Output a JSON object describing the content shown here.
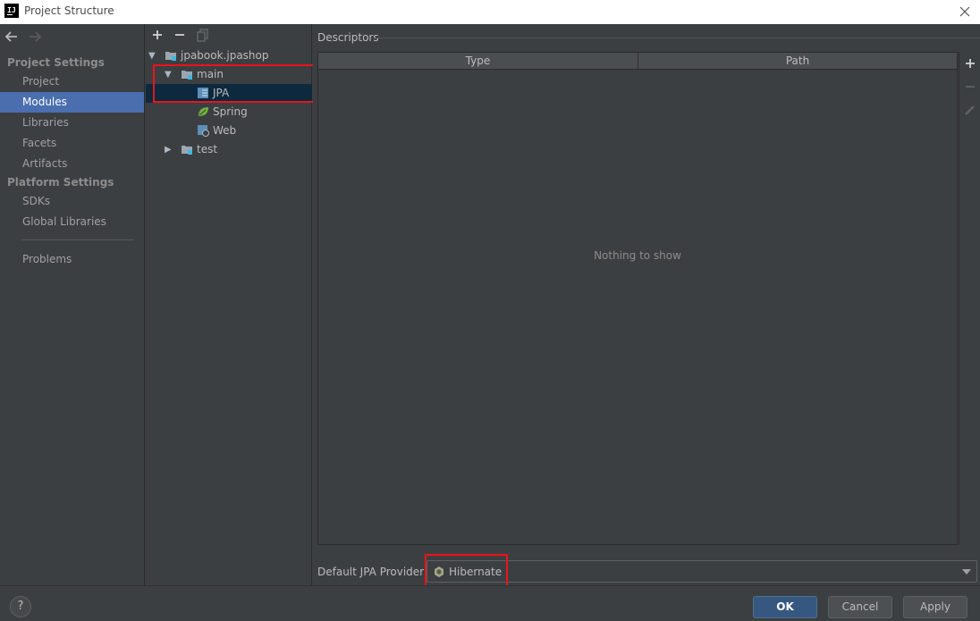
{
  "window": {
    "title": "Project Structure",
    "app_icon_text": "IJ"
  },
  "nav": {
    "project_settings_header": "Project Settings",
    "project_settings_items": [
      "Project",
      "Modules",
      "Libraries",
      "Facets",
      "Artifacts"
    ],
    "platform_settings_header": "Platform Settings",
    "platform_settings_items": [
      "SDKs",
      "Global Libraries"
    ],
    "problems": "Problems",
    "selected": "Modules"
  },
  "tree": {
    "nodes": [
      {
        "label": "jpabook.jpashop",
        "expanded": true
      },
      {
        "label": "main",
        "expanded": true
      },
      {
        "label": "JPA",
        "selected": true
      },
      {
        "label": "Spring"
      },
      {
        "label": "Web"
      },
      {
        "label": "test",
        "expanded": false
      }
    ]
  },
  "descriptors": {
    "section_title": "Descriptors",
    "columns": [
      "Type",
      "Path"
    ],
    "empty_text": "Nothing to show"
  },
  "provider": {
    "label": "Default JPA Provider",
    "value": "Hibernate"
  },
  "buttons": {
    "help": "?",
    "ok": "OK",
    "cancel": "Cancel",
    "apply": "Apply"
  },
  "colors": {
    "background": "#3c3f41",
    "selection": "#4b6eaf",
    "tree_selection": "#0d293e",
    "highlight_box": "#e8141c",
    "primary_button": "#365880"
  },
  "icons": {
    "back": "arrow-left-icon",
    "forward": "arrow-right-icon",
    "add": "plus-icon",
    "remove": "minus-icon",
    "copy": "copy-icon",
    "edit": "pencil-icon",
    "module": "module-folder-icon",
    "jpa": "jpa-facet-icon",
    "spring": "spring-leaf-icon",
    "web": "web-facet-icon",
    "hibernate": "hibernate-icon",
    "close": "close-icon"
  }
}
